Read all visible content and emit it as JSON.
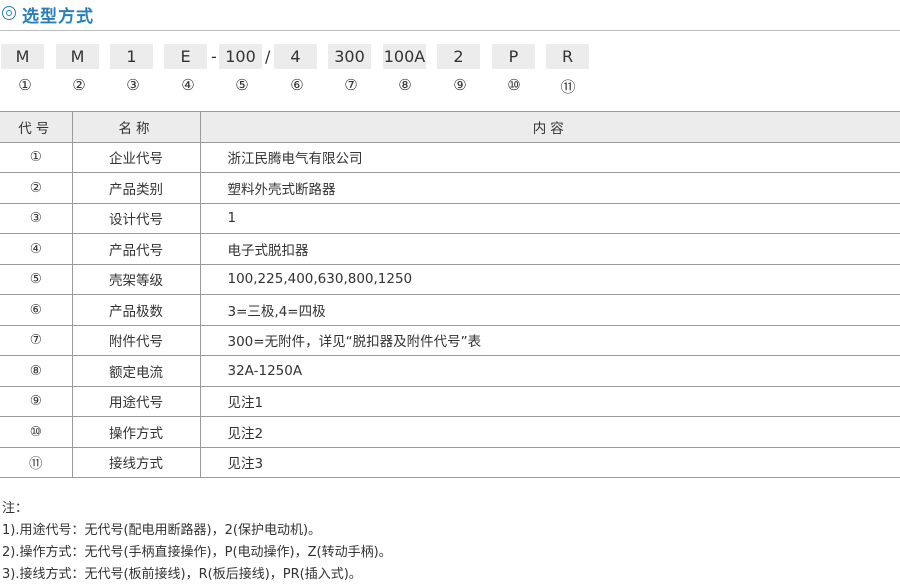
{
  "title": "选型方式",
  "code": {
    "boxes": [
      "M",
      "M",
      "1",
      "E",
      "100",
      "4",
      "300",
      "100A",
      "2",
      "P",
      "R"
    ],
    "separators": [
      "-",
      "/"
    ],
    "numbers": [
      "①",
      "②",
      "③",
      "④",
      "⑤",
      "⑥",
      "⑦",
      "⑧",
      "⑨",
      "⑩",
      "⑪"
    ]
  },
  "table": {
    "headers": [
      "代号",
      "名称",
      "内容"
    ],
    "rows": [
      [
        "①",
        "企业代号",
        "浙江民腾电气有限公司"
      ],
      [
        "②",
        "产品类别",
        "塑料外壳式断路器"
      ],
      [
        "③",
        "设计代号",
        "1"
      ],
      [
        "④",
        "产品代号",
        "电子式脱扣器"
      ],
      [
        "⑤",
        "壳架等级",
        "100,225,400,630,800,1250"
      ],
      [
        "⑥",
        "产品极数",
        "3=三极,4=四极"
      ],
      [
        "⑦",
        "附件代号",
        "300=无附件，详见“脱扣器及附件代号”表"
      ],
      [
        "⑧",
        "额定电流",
        "32A-1250A"
      ],
      [
        "⑨",
        "用途代号",
        "见注1"
      ],
      [
        "⑩",
        "操作方式",
        "见注2"
      ],
      [
        "⑪",
        "接线方式",
        "见注3"
      ]
    ]
  },
  "notes": {
    "heading": "注：",
    "items": [
      "1).用途代号：无代号(配电用断路器)，2(保护电动机)。",
      "2).操作方式：无代号(手柄直接操作)，P(电动操作)，Z(转动手柄)。",
      "3).接线方式：无代号(板前接线)，R(板后接线)，PR(插入式)。"
    ]
  },
  "colors": {
    "accent": "#2a7fb8",
    "box_bg": "#ececec",
    "rule": "#9a9a9a"
  },
  "icons": {
    "title_marker": "double-circle-icon"
  }
}
